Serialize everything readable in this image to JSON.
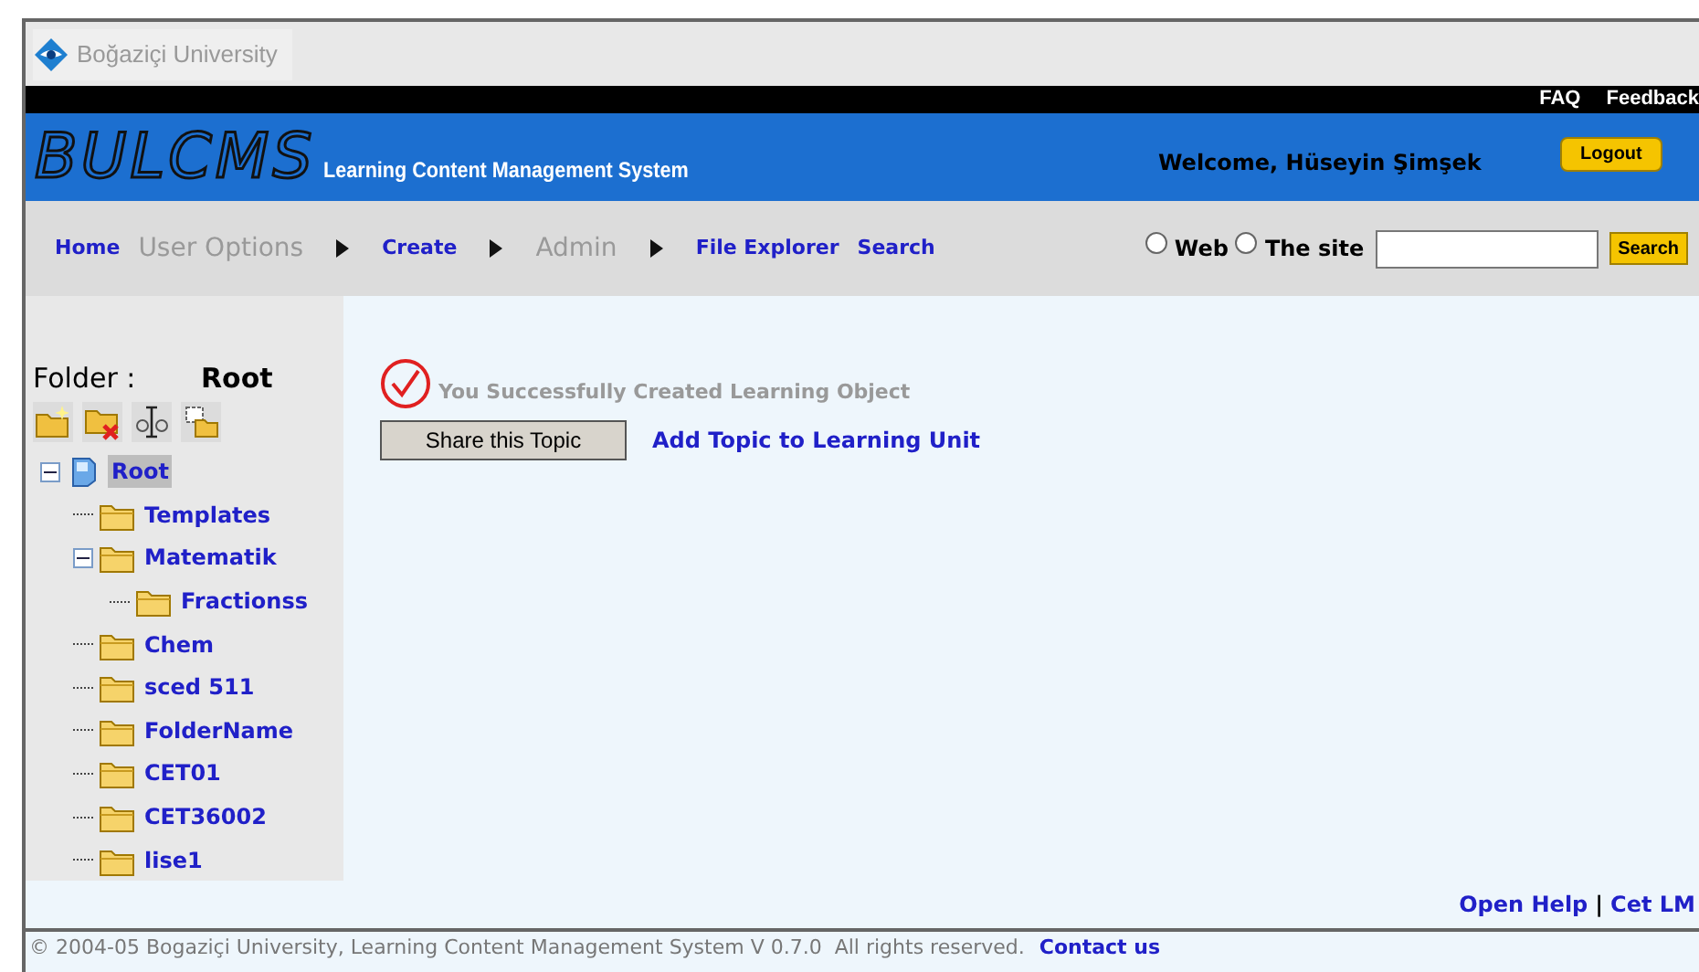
{
  "browser_tab": {
    "title": "Boğaziçi University"
  },
  "top_links": [
    "FAQ",
    "Feedback"
  ],
  "banner": {
    "logo": "BULCMS",
    "subtitle": "Learning Content Management System",
    "welcome": "Welcome, Hüseyin Şimşek",
    "logout": "Logout"
  },
  "nav": [
    {
      "label": "Home",
      "disabled": false,
      "submenu": false
    },
    {
      "label": "User Options",
      "disabled": true,
      "submenu": true
    },
    {
      "label": "Create",
      "disabled": false,
      "submenu": true
    },
    {
      "label": "Admin",
      "disabled": true,
      "submenu": true
    },
    {
      "label": "File Explorer",
      "disabled": false,
      "submenu": false
    },
    {
      "label": "Search",
      "disabled": false,
      "submenu": false
    }
  ],
  "search": {
    "scopes": [
      {
        "label": "Web",
        "selected": false
      },
      {
        "label": "The site",
        "selected": false
      }
    ],
    "button": "Search"
  },
  "sidebar": {
    "folder_label": "Folder :",
    "folder_name": "Root",
    "tree": [
      {
        "label": "Root",
        "kind": "root",
        "selected": true,
        "expanded": true,
        "children": [
          {
            "label": "Templates",
            "kind": "folder",
            "selected": false
          },
          {
            "label": "Matematik",
            "kind": "folder",
            "selected": false,
            "expanded": true,
            "children": [
              {
                "label": "Fractionss",
                "kind": "folder",
                "selected": false
              }
            ]
          },
          {
            "label": "Chem",
            "kind": "folder",
            "selected": false
          },
          {
            "label": "sced 511",
            "kind": "folder",
            "selected": false
          },
          {
            "label": "FolderName",
            "kind": "folder",
            "selected": false
          },
          {
            "label": "CET01",
            "kind": "folder",
            "selected": false
          },
          {
            "label": "CET36002",
            "kind": "folder",
            "selected": false
          },
          {
            "label": "lise1",
            "kind": "folder",
            "selected": false
          }
        ]
      }
    ]
  },
  "content": {
    "message": "You Successfully Created Learning Object",
    "share_button": "Share this Topic",
    "add_link": "Add Topic to Learning Unit"
  },
  "footer": {
    "links": [
      "Open Help",
      "Cet LM"
    ],
    "separator": "|",
    "copyright": "© 2004-05 Bogaziçi University, Learning Content Management System V 0.7.0  All rights reserved.",
    "contact": "Contact us"
  }
}
